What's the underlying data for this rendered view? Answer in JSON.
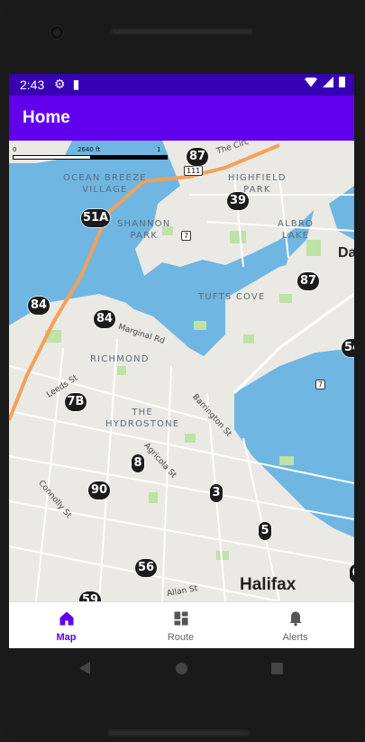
{
  "status": {
    "time": "2:43"
  },
  "appbar": {
    "title": "Home"
  },
  "map": {
    "scale": {
      "zero": "0",
      "mid": "2640 ft",
      "end": "1 mi"
    },
    "areas": [
      {
        "name": "ocean-breeze-village",
        "text": "OCEAN BREEZE\nVILLAGE"
      },
      {
        "name": "highfield-park",
        "text": "HIGHFIELD\nPARK"
      },
      {
        "name": "shannon-park",
        "text": "SHANNON\nPARK"
      },
      {
        "name": "albro-lake",
        "text": "ALBRO\nLAKE"
      },
      {
        "name": "tufts-cove",
        "text": "TUFTS COVE"
      },
      {
        "name": "richmond",
        "text": "RICHMOND"
      },
      {
        "name": "the-hydrostone",
        "text": "THE\nHYDROSTONE"
      }
    ],
    "streets": {
      "the_circ": "The Circ",
      "marginal": "Marginal Rd",
      "leeds": "Leeds St",
      "barrington": "Barrington St",
      "agricola": "Agricola St",
      "connolly": "Connolly St",
      "allan": "Allan St"
    },
    "city": "Halifax",
    "city_partial": "Da",
    "highway_111": "111",
    "route_7a": "7",
    "route_7b": "7",
    "stops": [
      "87",
      "39",
      "51A",
      "87",
      "84",
      "84",
      "54",
      "7B",
      "8",
      "90",
      "3",
      "5",
      "56",
      "6",
      "59"
    ]
  },
  "nav": {
    "items": [
      {
        "label": "Map",
        "active": true
      },
      {
        "label": "Route",
        "active": false
      },
      {
        "label": "Alerts",
        "active": false
      }
    ],
    "accent": "#6200ee"
  }
}
